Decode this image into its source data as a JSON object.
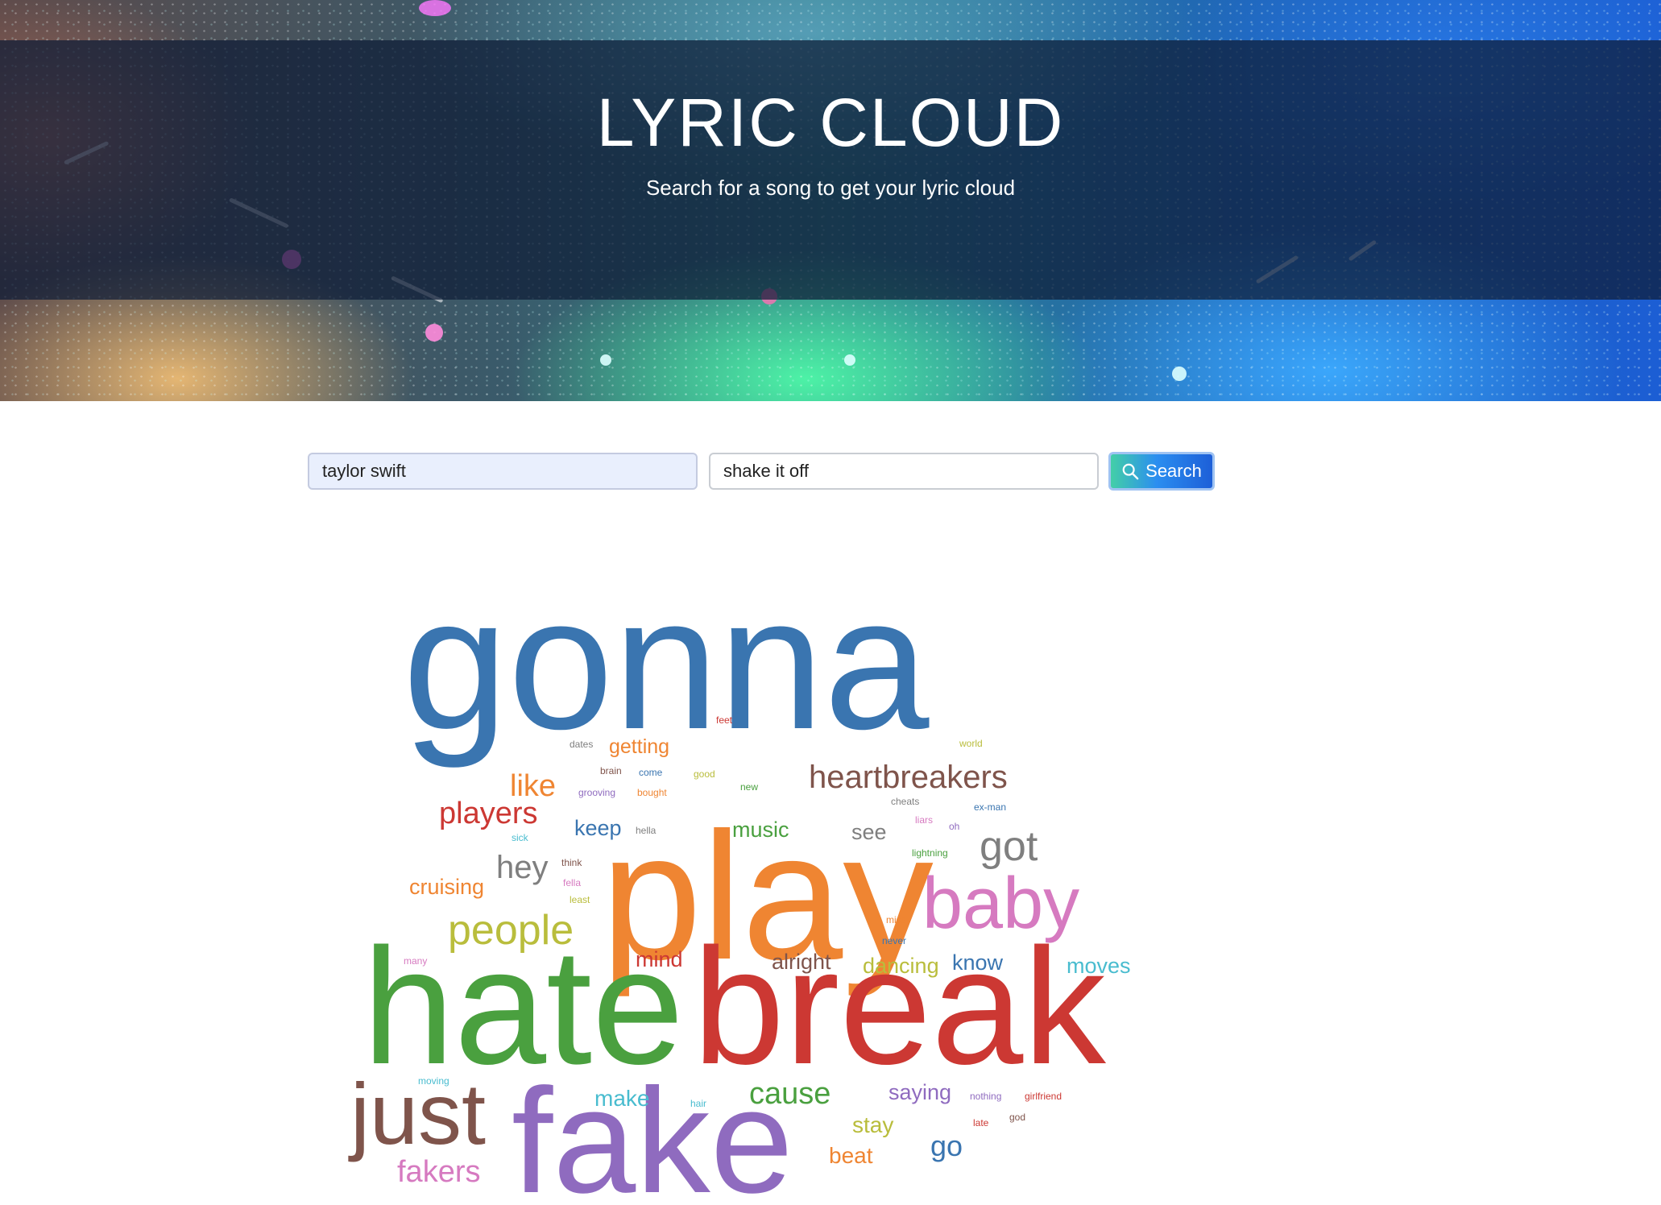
{
  "header": {
    "title": "LYRIC CLOUD",
    "subtitle": "Search for a song to get your lyric cloud"
  },
  "search": {
    "artist_value": "taylor swift",
    "song_value": "shake it off",
    "button_label": "Search",
    "button_icon": "search-icon"
  },
  "cloud": {
    "words": [
      {
        "text": "gonna",
        "color": "#3a75b0"
      },
      {
        "text": "play",
        "color": "#ef8532"
      },
      {
        "text": "hate",
        "color": "#4aa03f"
      },
      {
        "text": "break",
        "color": "#cc3833"
      },
      {
        "text": "fake",
        "color": "#8f6bbf"
      },
      {
        "text": "just",
        "color": "#7f544b"
      },
      {
        "text": "baby",
        "color": "#d67ac0"
      },
      {
        "text": "people",
        "color": "#b9bd3c"
      },
      {
        "text": "got",
        "color": "#7f7f7f"
      },
      {
        "text": "heartbreakers",
        "color": "#7f544b"
      },
      {
        "text": "players",
        "color": "#cc3833"
      },
      {
        "text": "like",
        "color": "#ef8532"
      },
      {
        "text": "hey",
        "color": "#7f7f7f"
      },
      {
        "text": "cruising",
        "color": "#ef8532"
      },
      {
        "text": "keep",
        "color": "#3a75b0"
      },
      {
        "text": "music",
        "color": "#4aa03f"
      },
      {
        "text": "see",
        "color": "#7f7f7f"
      },
      {
        "text": "getting",
        "color": "#ef8532"
      },
      {
        "text": "cause",
        "color": "#4aa03f"
      },
      {
        "text": "make",
        "color": "#49bccf"
      },
      {
        "text": "fakers",
        "color": "#d67ac0"
      },
      {
        "text": "saying",
        "color": "#8f6bbf"
      },
      {
        "text": "stay",
        "color": "#b9bd3c"
      },
      {
        "text": "beat",
        "color": "#ef8532"
      },
      {
        "text": "go",
        "color": "#3a75b0"
      },
      {
        "text": "mind",
        "color": "#cc3833"
      },
      {
        "text": "alright",
        "color": "#7f544b"
      },
      {
        "text": "dancing",
        "color": "#b9bd3c"
      },
      {
        "text": "know",
        "color": "#3a75b0"
      },
      {
        "text": "moves",
        "color": "#49bccf"
      },
      {
        "text": "feet",
        "color": "#cc3833"
      },
      {
        "text": "dates",
        "color": "#7f7f7f"
      },
      {
        "text": "brain",
        "color": "#7f544b"
      },
      {
        "text": "come",
        "color": "#3a75b0"
      },
      {
        "text": "good",
        "color": "#b9bd3c"
      },
      {
        "text": "grooving",
        "color": "#8f6bbf"
      },
      {
        "text": "bought",
        "color": "#ef8532"
      },
      {
        "text": "new",
        "color": "#4aa03f"
      },
      {
        "text": "world",
        "color": "#b9bd3c"
      },
      {
        "text": "cheats",
        "color": "#7f7f7f"
      },
      {
        "text": "ex-man",
        "color": "#3a75b0"
      },
      {
        "text": "liars",
        "color": "#d67ac0"
      },
      {
        "text": "oh",
        "color": "#8f6bbf"
      },
      {
        "text": "hella",
        "color": "#7f7f7f"
      },
      {
        "text": "sick",
        "color": "#49bccf"
      },
      {
        "text": "lightning",
        "color": "#4aa03f"
      },
      {
        "text": "think",
        "color": "#7f544b"
      },
      {
        "text": "fella",
        "color": "#d67ac0"
      },
      {
        "text": "least",
        "color": "#b9bd3c"
      },
      {
        "text": "miss",
        "color": "#ef8532"
      },
      {
        "text": "never",
        "color": "#3a75b0"
      },
      {
        "text": "many",
        "color": "#d67ac0"
      },
      {
        "text": "moving",
        "color": "#49bccf"
      },
      {
        "text": "hair",
        "color": "#49bccf"
      },
      {
        "text": "nothing",
        "color": "#8f6bbf"
      },
      {
        "text": "girlfriend",
        "color": "#cc3833"
      },
      {
        "text": "late",
        "color": "#cc3833"
      },
      {
        "text": "god",
        "color": "#7f544b"
      }
    ]
  }
}
